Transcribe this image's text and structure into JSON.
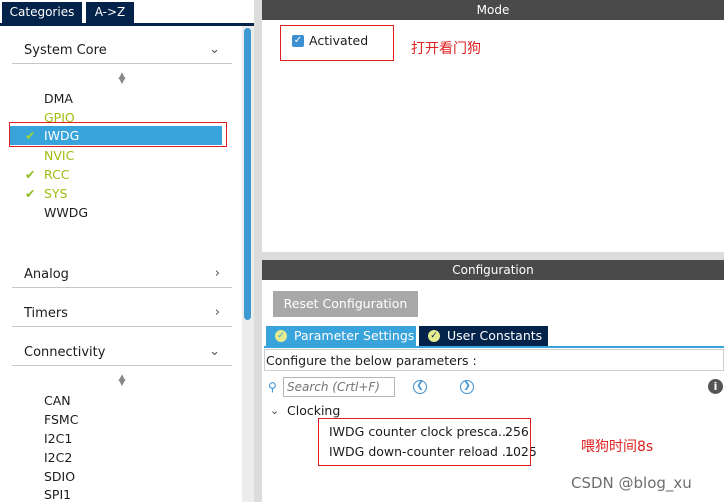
{
  "left_tabs": {
    "categories": "Categories",
    "az": "A->Z"
  },
  "sections": {
    "system_core": "System Core",
    "analog": "Analog",
    "timers": "Timers",
    "connectivity": "Connectivity"
  },
  "system_core_items": [
    {
      "label": "DMA",
      "checked": false,
      "color": "#1c1c1c"
    },
    {
      "label": "GPIO",
      "checked": false,
      "color": "#9fbd10"
    },
    {
      "label": "IWDG",
      "checked": true,
      "selected": true
    },
    {
      "label": "NVIC",
      "checked": false,
      "color": "#9fbd10"
    },
    {
      "label": "RCC",
      "checked": true,
      "color": "#9fbd10"
    },
    {
      "label": "SYS",
      "checked": true,
      "color": "#9fbd10"
    },
    {
      "label": "WWDG",
      "checked": false,
      "color": "#1c1c1c"
    }
  ],
  "connectivity_items": [
    "CAN",
    "FSMC",
    "I2C1",
    "I2C2",
    "SDIO",
    "SPI1"
  ],
  "mode": {
    "header": "Mode",
    "activated_label": "Activated",
    "activated_checked": true,
    "annotation": "打开看门狗"
  },
  "configuration": {
    "header": "Configuration",
    "reset_button": "Reset Configuration",
    "tab_parameter_settings": "Parameter Settings",
    "tab_user_constants": "User Constants",
    "hint": "Configure the below parameters :",
    "search_placeholder": "Search (Crtl+F)",
    "group_clocking": "Clocking",
    "params": [
      {
        "name": "IWDG counter clock presca...",
        "value": "256"
      },
      {
        "name": "IWDG down-counter reload ...",
        "value": "1025"
      }
    ],
    "annotation": "喂狗时间8s"
  },
  "watermark": "CSDN @blog_xu",
  "colors": {
    "tab_dark": "#03234b",
    "accent_blue": "#39a3dc",
    "check_green": "#8ebf1c",
    "annotation_red": "#e02020"
  }
}
